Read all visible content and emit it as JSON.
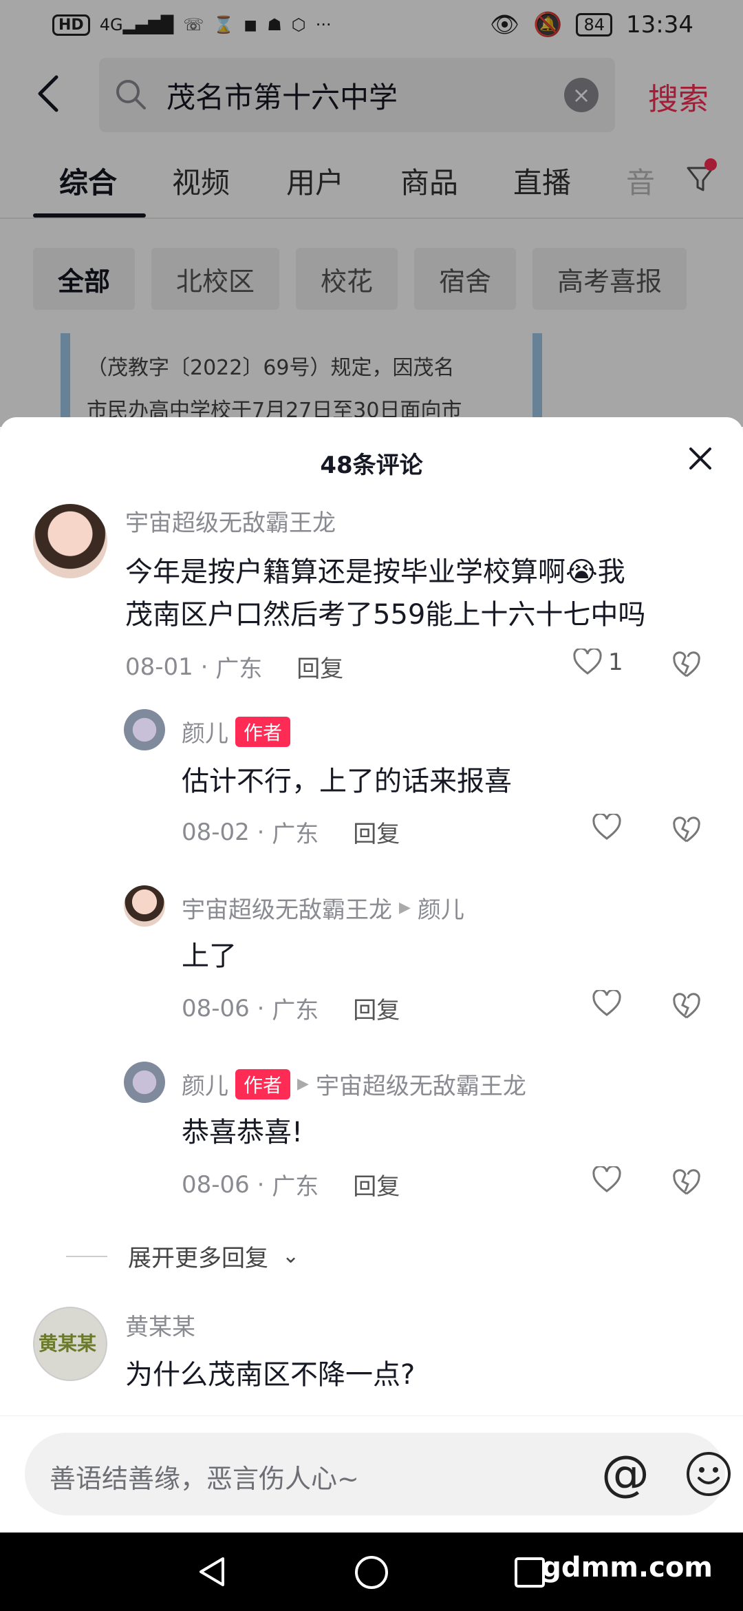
{
  "status_bar": {
    "left_icons": [
      "HD",
      "4G signal",
      "missed call",
      "hourglass",
      "app",
      "qq",
      "vpn",
      "more"
    ],
    "hd": "HD",
    "net": "4G",
    "more": "···",
    "battery": "84",
    "time": "13:34"
  },
  "search": {
    "query": "茂名市第十六中学",
    "button": "搜索"
  },
  "tabs": [
    "综合",
    "视频",
    "用户",
    "商品",
    "直播",
    "音"
  ],
  "chips": [
    "全部",
    "北校区",
    "校花",
    "宿舍",
    "高考喜报"
  ],
  "snippet": {
    "line1": "（茂教字〔2022〕69号）规定，因茂名",
    "line2": "市民办高中学校于7月27日至30日面向市"
  },
  "sheet": {
    "title": "48条评论"
  },
  "comments": [
    {
      "user": "宇宙超级无敌霸王龙",
      "text_line1": "今年是按户籍算还是按毕业学校算啊😭我",
      "text_line2": "茂南区户口然后考了559能上十六十七中吗",
      "date": "08-01",
      "sep": "·",
      "location": "广东",
      "reply": "回复",
      "likes": "1"
    },
    {
      "user": "颜儿",
      "tag": "作者",
      "text": "估计不行，上了的话来报喜",
      "date": "08-02",
      "sep": "·",
      "location": "广东",
      "reply": "回复"
    },
    {
      "user": "宇宙超级无敌霸王龙",
      "reply_to": "颜儿",
      "text": "上了",
      "date": "08-06",
      "sep": "·",
      "location": "广东",
      "reply": "回复"
    },
    {
      "user": "颜儿",
      "tag": "作者",
      "reply_to": "宇宙超级无敌霸王龙",
      "text": "恭喜恭喜!",
      "date": "08-06",
      "sep": "·",
      "location": "广东",
      "reply": "回复"
    },
    {
      "user": "黄某某",
      "avatar_text": "黄某某",
      "text": "为什么茂南区不降一点?"
    }
  ],
  "expand": "展开更多回复",
  "input": {
    "placeholder": "善语结善缘，恶言伤人心~",
    "at": "@"
  },
  "watermark": "gdmm.com",
  "colors": {
    "accent": "#fe2c55",
    "text": "#161823",
    "secondary": "#8a8b91"
  }
}
